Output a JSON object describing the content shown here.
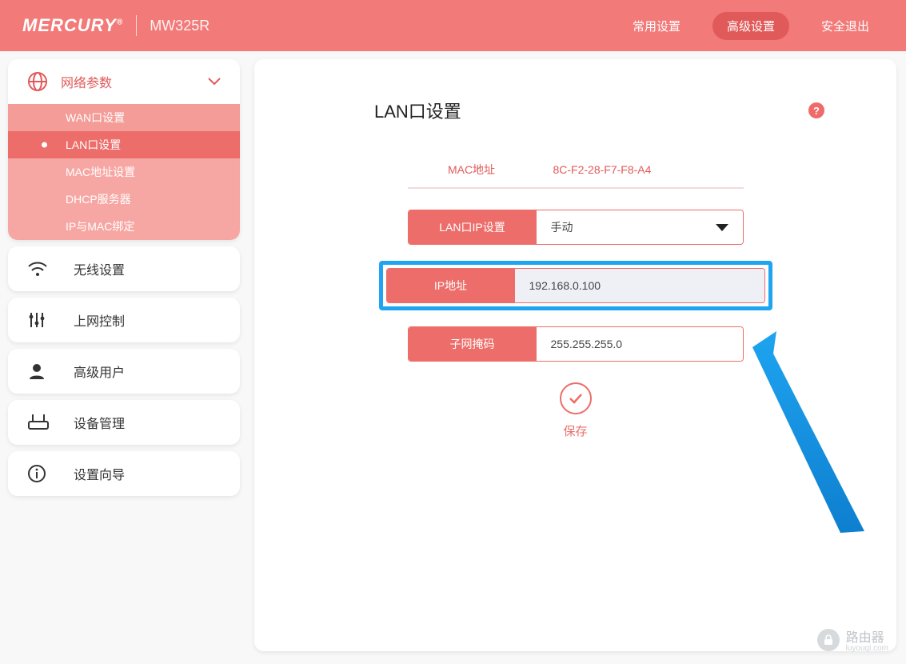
{
  "header": {
    "brand": "MERCURY",
    "model": "MW325R",
    "nav": {
      "common": "常用设置",
      "advanced": "高级设置",
      "logout": "安全退出"
    }
  },
  "sidebar": {
    "network": {
      "label": "网络参数",
      "items": [
        "WAN口设置",
        "LAN口设置",
        "MAC地址设置",
        "DHCP服务器",
        "IP与MAC绑定"
      ]
    },
    "wireless": "无线设置",
    "access": "上网控制",
    "advuser": "高级用户",
    "device": "设备管理",
    "wizard": "设置向导"
  },
  "main": {
    "title": "LAN口设置",
    "mac_label": "MAC地址",
    "mac_value": "8C-F2-28-F7-F8-A4",
    "lan_ip_setting_label": "LAN口IP设置",
    "lan_ip_setting_value": "手动",
    "ip_label": "IP地址",
    "ip_value": "192.168.0.100",
    "mask_label": "子网掩码",
    "mask_value": "255.255.255.0",
    "save": "保存"
  },
  "watermark": {
    "text": "路由器",
    "sub": "luyouqi.com"
  }
}
